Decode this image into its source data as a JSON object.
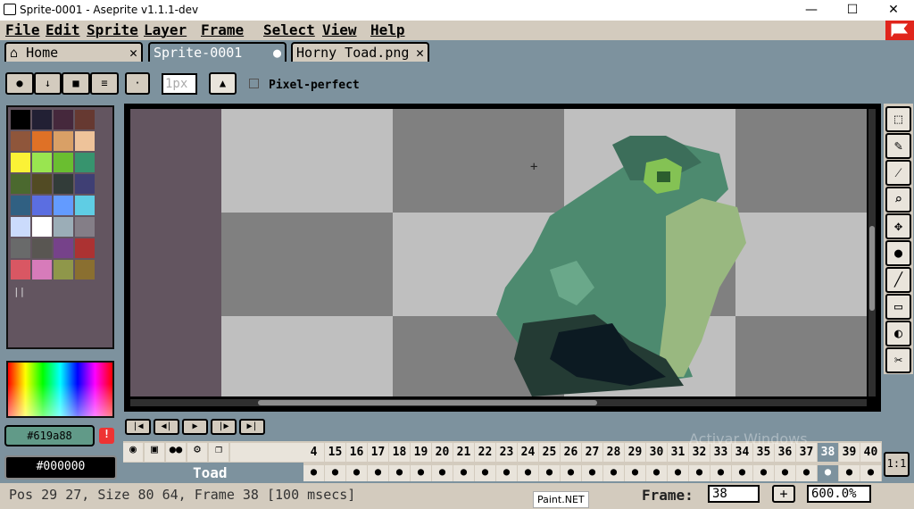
{
  "window": {
    "title": "Sprite-0001 - Aseprite v1.1.1-dev",
    "minimize": "—",
    "maximize": "☐",
    "close": "✕"
  },
  "menu": [
    "File",
    "Edit",
    "Sprite",
    "Layer",
    "Frame",
    "Select",
    "View",
    "Help"
  ],
  "tabs": {
    "home": "Home",
    "active": "Sprite-0001",
    "other": "Horny Toad.png"
  },
  "toolbar": {
    "brush_size": "1px",
    "pixel_perfect": "Pixel-perfect"
  },
  "palette": {
    "colors": [
      "#000000",
      "#222034",
      "#45283c",
      "#663931",
      "#8f563b",
      "#df7126",
      "#d9a066",
      "#eec39a",
      "#fbf236",
      "#99e550",
      "#6abe30",
      "#37946e",
      "#4b692f",
      "#524b24",
      "#323c39",
      "#3f3f74",
      "#306082",
      "#5b6ee1",
      "#639bff",
      "#5fcde4",
      "#cbdbfc",
      "#ffffff",
      "#9badb7",
      "#847e87",
      "#696a6a",
      "#595652",
      "#76428a",
      "#ac3232",
      "#d95763",
      "#d77bba",
      "#8f974a",
      "#8a6f30"
    ],
    "fg": "#619a88",
    "bg": "#000000",
    "warn": "!"
  },
  "tools": [
    "marquee-icon",
    "pencil-icon",
    "eyedropper-icon",
    "zoom-icon",
    "move-icon",
    "fill-icon",
    "line-icon",
    "rectangle-icon",
    "blur-icon",
    "eraser-tool-icon"
  ],
  "timeline": {
    "frames": [
      "4",
      "15",
      "16",
      "17",
      "18",
      "19",
      "20",
      "21",
      "22",
      "23",
      "24",
      "25",
      "26",
      "27",
      "28",
      "29",
      "30",
      "31",
      "32",
      "33",
      "34",
      "35",
      "36",
      "37",
      "38",
      "39",
      "40"
    ],
    "current_frame": "38",
    "layer": "Toad"
  },
  "status": {
    "text": "Pos 29 27, Size 80 64, Frame 38 [100 msecs]",
    "frame_label": "Frame:",
    "frame_value": "38",
    "plus": "+",
    "zoom": "600.0%"
  },
  "tooltip": "Paint.NET",
  "watermark": "Activar Windows"
}
